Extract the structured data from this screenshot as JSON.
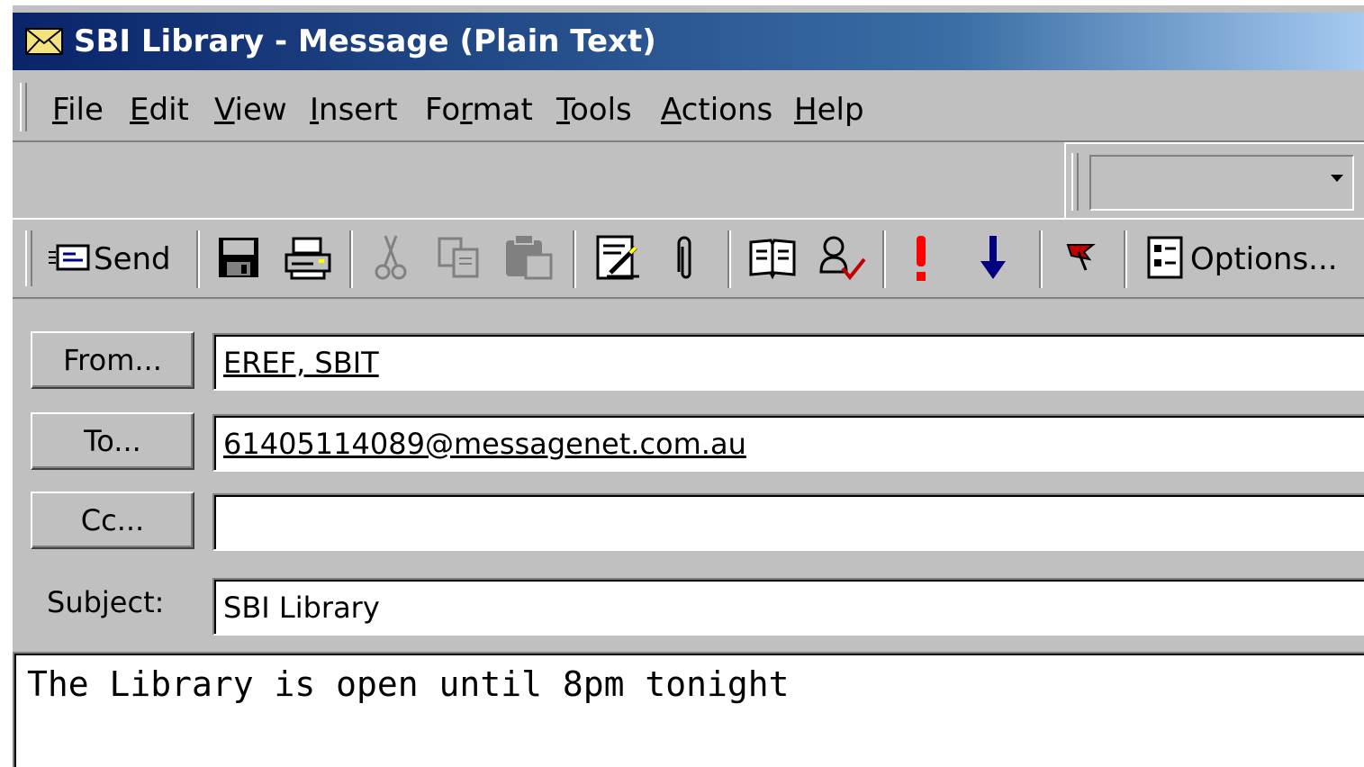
{
  "window": {
    "title": "SBI Library - Message (Plain Text)"
  },
  "menu": {
    "items": [
      {
        "label": "File"
      },
      {
        "label": "Edit"
      },
      {
        "label": "View"
      },
      {
        "label": "Insert"
      },
      {
        "label": "Format"
      },
      {
        "label": "Tools"
      },
      {
        "label": "Actions"
      },
      {
        "label": "Help"
      }
    ]
  },
  "toolbar": {
    "send_label": "Send",
    "options_label": "Options..."
  },
  "format_combo": {
    "value": ""
  },
  "header": {
    "from_button": "From...",
    "from_value": "EREF, SBIT",
    "to_button": "To...",
    "to_value": "61405114089@messagenet.com.au",
    "cc_button": "Cc...",
    "cc_value": "",
    "subject_label": "Subject:",
    "subject_value": "SBI Library"
  },
  "body": {
    "text": "The Library is open until 8pm tonight"
  },
  "colors": {
    "title_start": "#0a246a",
    "title_end": "#a6caf0",
    "importance_high": "#ff0000",
    "importance_low": "#000080",
    "face": "#c0c0c0"
  }
}
